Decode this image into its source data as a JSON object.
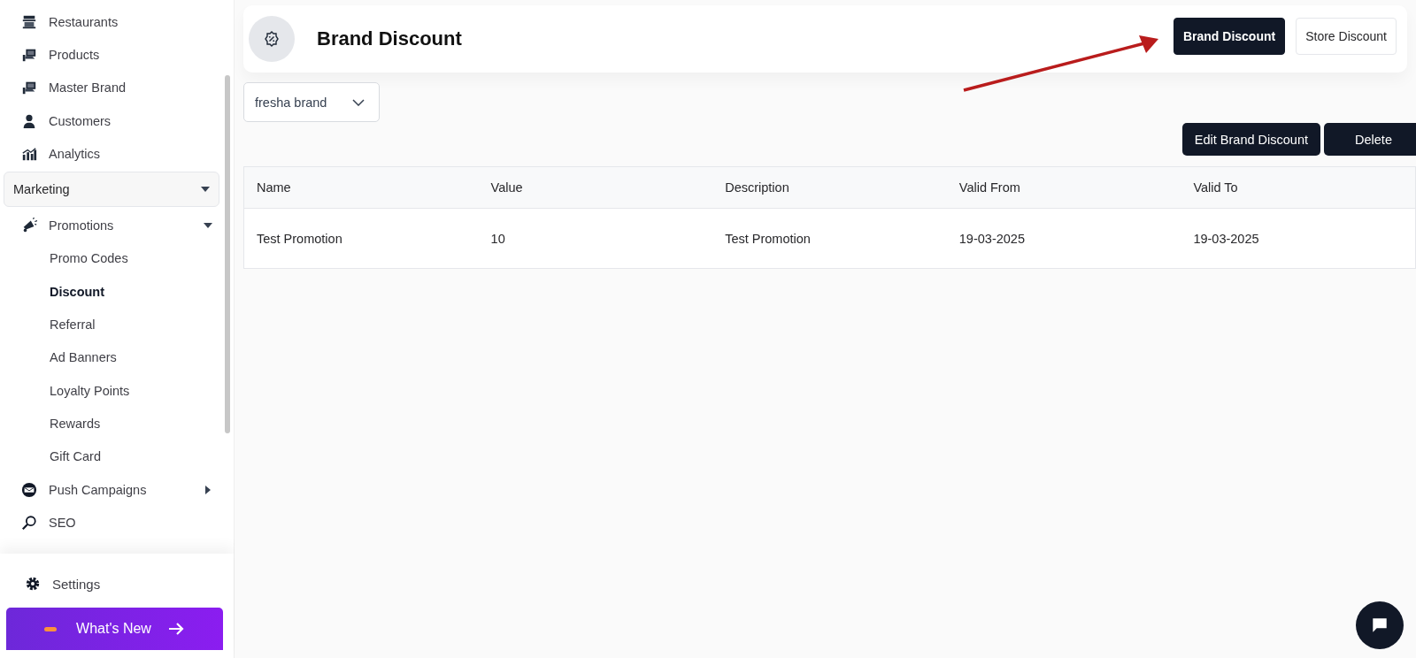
{
  "sidebar": {
    "items": [
      {
        "label": "Restaurants"
      },
      {
        "label": "Products"
      },
      {
        "label": "Master Brand"
      },
      {
        "label": "Customers"
      },
      {
        "label": "Analytics"
      }
    ],
    "section": {
      "label": "Marketing",
      "expanded": true,
      "items": [
        {
          "label": "Promotions",
          "expanded": true,
          "children": [
            {
              "label": "Promo Codes",
              "selected": false
            },
            {
              "label": "Discount",
              "selected": true
            },
            {
              "label": "Referral",
              "selected": false
            },
            {
              "label": "Ad Banners",
              "selected": false
            },
            {
              "label": "Loyalty Points",
              "selected": false
            },
            {
              "label": "Rewards",
              "selected": false
            },
            {
              "label": "Gift Card",
              "selected": false
            }
          ]
        },
        {
          "label": "Push Campaigns",
          "expanded": false
        },
        {
          "label": "SEO"
        }
      ]
    },
    "settings": "Settings",
    "whats_new": "What's New"
  },
  "header": {
    "title": "Brand Discount",
    "tabs": [
      {
        "label": "Brand Discount",
        "selected": true
      },
      {
        "label": "Store Discount",
        "selected": false
      }
    ]
  },
  "brand_select": {
    "value": "fresha brand"
  },
  "actions": [
    "Edit Brand Discount",
    "Delete"
  ],
  "table": {
    "columns": [
      "Name",
      "Value",
      "Description",
      "Valid From",
      "Valid To"
    ],
    "rows": [
      [
        "Test Promotion",
        "10",
        "Test Promotion",
        "19-03-2025",
        "19-03-2025"
      ]
    ]
  }
}
